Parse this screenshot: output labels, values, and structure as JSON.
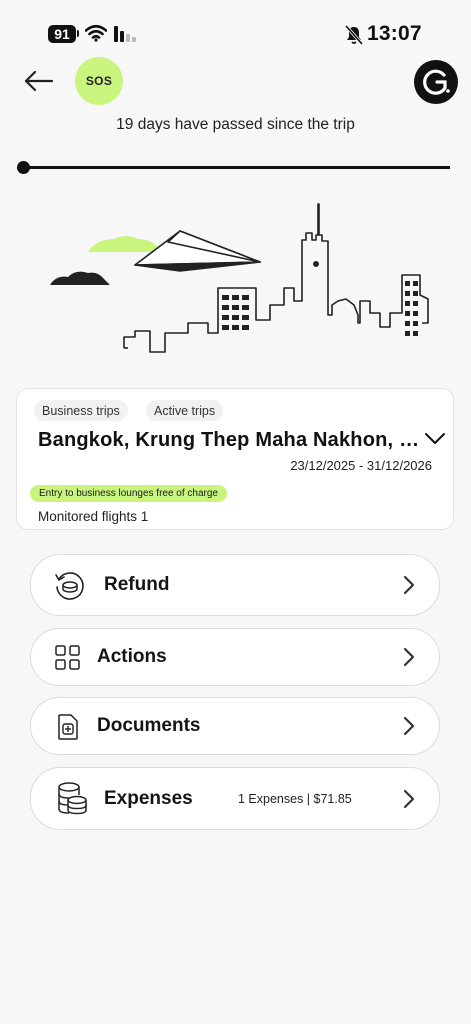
{
  "status_bar": {
    "battery": "91",
    "time": "13:07"
  },
  "header": {
    "sos_label": "SOS"
  },
  "trip": {
    "days_passed_text": "19 days have passed since the trip"
  },
  "card": {
    "chips": [
      "Business trips",
      "Active trips"
    ],
    "destination": "Bangkok, Krung Thep Maha Nakhon, Thailand",
    "dates": "23/12/2025 - 31/12/2026",
    "lounge_badge": "Entry to business lounges free of charge",
    "monitored_flights": "Monitored flights 1"
  },
  "menu": {
    "refund": "Refund",
    "actions": "Actions",
    "documents": "Documents",
    "expenses": "Expenses",
    "expenses_meta": "1 Expenses | $71.85"
  },
  "colors": {
    "accent": "#c9f57f",
    "background": "#f7f7f7",
    "text": "#111111"
  },
  "icons": [
    "back-arrow-icon",
    "logo-icon",
    "refund-icon",
    "grid-icon",
    "document-plus-icon",
    "coins-icon",
    "chevron-right-icon",
    "chevron-down-icon",
    "wifi-icon",
    "signal-icon",
    "bell-off-icon"
  ]
}
